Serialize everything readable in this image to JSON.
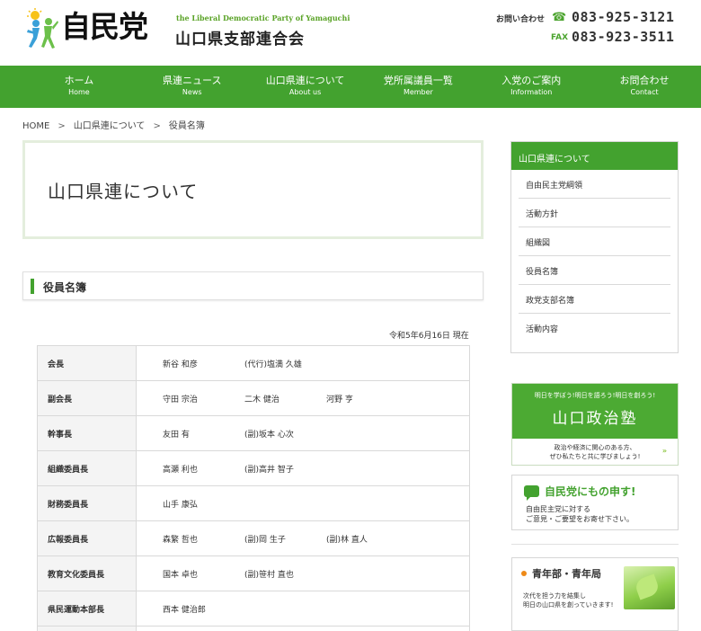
{
  "header": {
    "logo_kanji": "自民党",
    "logo_en": "the Liberal Democratic Party of Yamaguchi",
    "logo_ja": "山口県支部連合会",
    "contact_label": "お問い合わせ",
    "tel": "083-925-3121",
    "fax_label": "FAX",
    "fax": "083-923-3511"
  },
  "nav": [
    {
      "ja": "ホーム",
      "en": "Home"
    },
    {
      "ja": "県連ニュース",
      "en": "News"
    },
    {
      "ja": "山口県連について",
      "en": "About us"
    },
    {
      "ja": "党所属議員一覧",
      "en": "Member"
    },
    {
      "ja": "入党のご案内",
      "en": "Information"
    },
    {
      "ja": "お問合わせ",
      "en": "Contact"
    }
  ],
  "breadcrumb": [
    "HOME",
    "山口県連について",
    "役員名簿"
  ],
  "page_title": "山口県連について",
  "section_title": "役員名簿",
  "as_of": "令和5年6月16日 現在",
  "officers": [
    {
      "role": "会長",
      "names": [
        "新谷 和彦",
        "(代行)塩満 久雄"
      ]
    },
    {
      "role": "副会長",
      "names": [
        "守田 宗治",
        "二木 健治",
        "河野 亨"
      ]
    },
    {
      "role": "幹事長",
      "names": [
        "友田 有",
        "(副)坂本 心次"
      ]
    },
    {
      "role": "組織委員長",
      "names": [
        "高瀬 利也",
        "(副)高井 智子"
      ]
    },
    {
      "role": "財務委員長",
      "names": [
        "山手 康弘"
      ]
    },
    {
      "role": "広報委員長",
      "names": [
        "森繁 哲也",
        "(副)岡 生子",
        "(副)林 直人"
      ]
    },
    {
      "role": "教育文化委員長",
      "names": [
        "国本 卓也",
        "(副)笹村 直也"
      ]
    },
    {
      "role": "県民運動本部長",
      "names": [
        "西本 健治郎"
      ]
    },
    {
      "role": "",
      "names": []
    }
  ],
  "sidebar": {
    "head": "山口県連について",
    "items": [
      "自由民主党綱領",
      "活動方針",
      "組織図",
      "役員名簿",
      "政党支部名簿",
      "活動内容"
    ]
  },
  "banner_juku": {
    "tag": "明日を学ぼう!明日を語ろう!明日を創ろう!",
    "title": "山口政治塾",
    "sub1": "政治や経済に関心のある方、",
    "sub2": "ぜひ私たちと共に学びましょう!",
    "arrow": "»"
  },
  "banner_moshu": {
    "title": "自民党にもの申す!",
    "sub1": "自由民主党に対する",
    "sub2": "ご意見・ご要望をお寄せ下さい。"
  },
  "banner_youth": {
    "title": "青年部・青年局",
    "sub1": "次代を担う力を結集し",
    "sub2": "明日の山口県を創っていきます!"
  },
  "colors": {
    "brand_green": "#43a22f",
    "accent_orange": "#ee8a18"
  }
}
